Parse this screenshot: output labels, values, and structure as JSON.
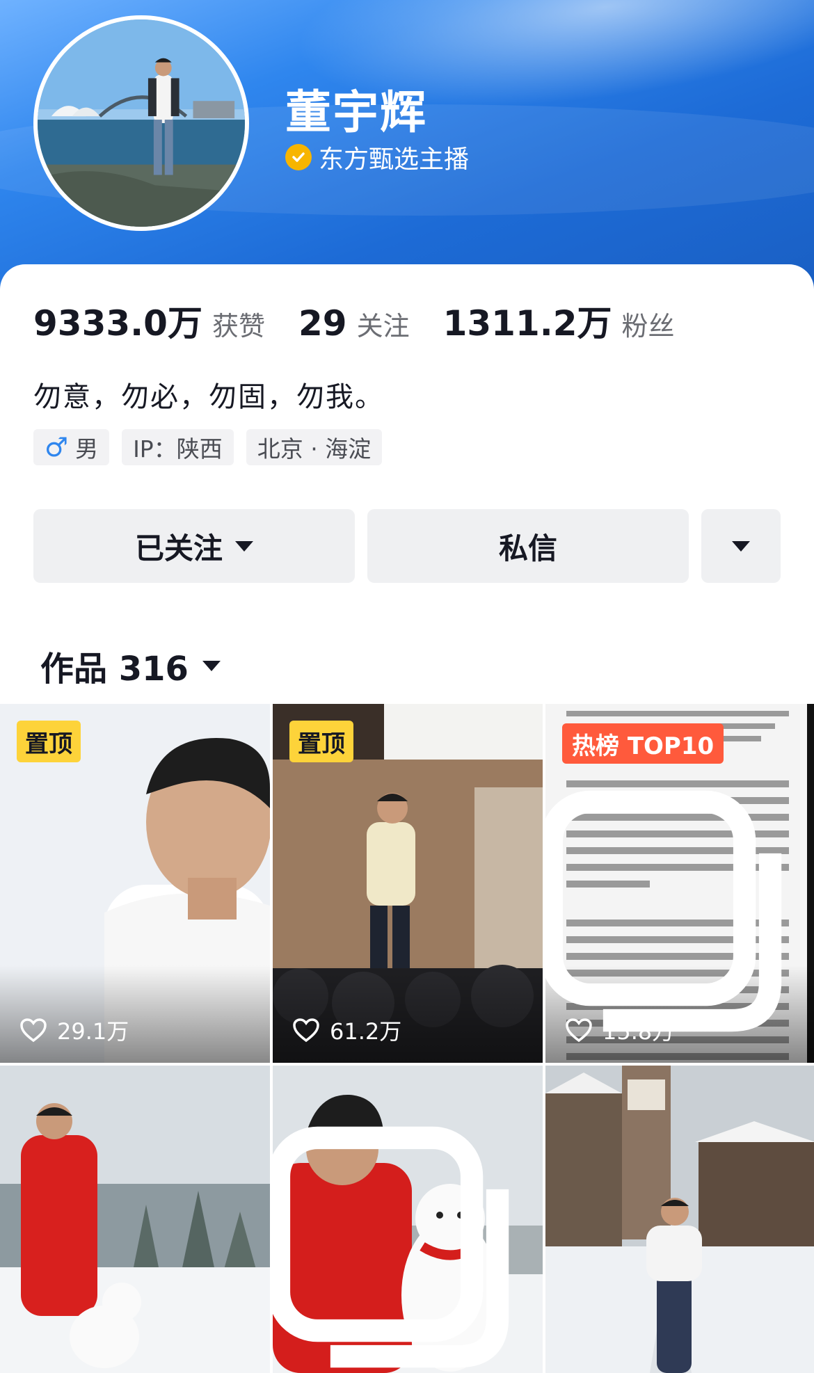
{
  "profile": {
    "name": "董宇辉",
    "verification": "东方甄选主播"
  },
  "stats": [
    {
      "value": "9333.0万",
      "label": "获赞"
    },
    {
      "value": "29",
      "label": "关注"
    },
    {
      "value": "1311.2万",
      "label": "粉丝"
    }
  ],
  "bio": "勿意，勿必，勿固，勿我。",
  "tags": {
    "gender_symbol": "♂",
    "gender": "男",
    "ip": "IP：陕西",
    "location": "北京 · 海淀"
  },
  "actions": {
    "follow_label": "已关注",
    "message_label": "私信"
  },
  "works": {
    "title": "作品 316"
  },
  "tiles": [
    {
      "badge": "置顶",
      "likes": "29.1万"
    },
    {
      "badge": "置顶",
      "likes": "61.2万"
    },
    {
      "badge": "热榜 TOP10",
      "likes": "15.8万"
    },
    {
      "badge": "",
      "likes": ""
    },
    {
      "badge": "",
      "likes": ""
    },
    {
      "badge": "",
      "likes": ""
    }
  ],
  "colors": {
    "banner": "#2f86ee",
    "pin_badge": "#fdd33a",
    "hot_badge": "#ff5a3c",
    "verify_badge": "#f7b500"
  }
}
